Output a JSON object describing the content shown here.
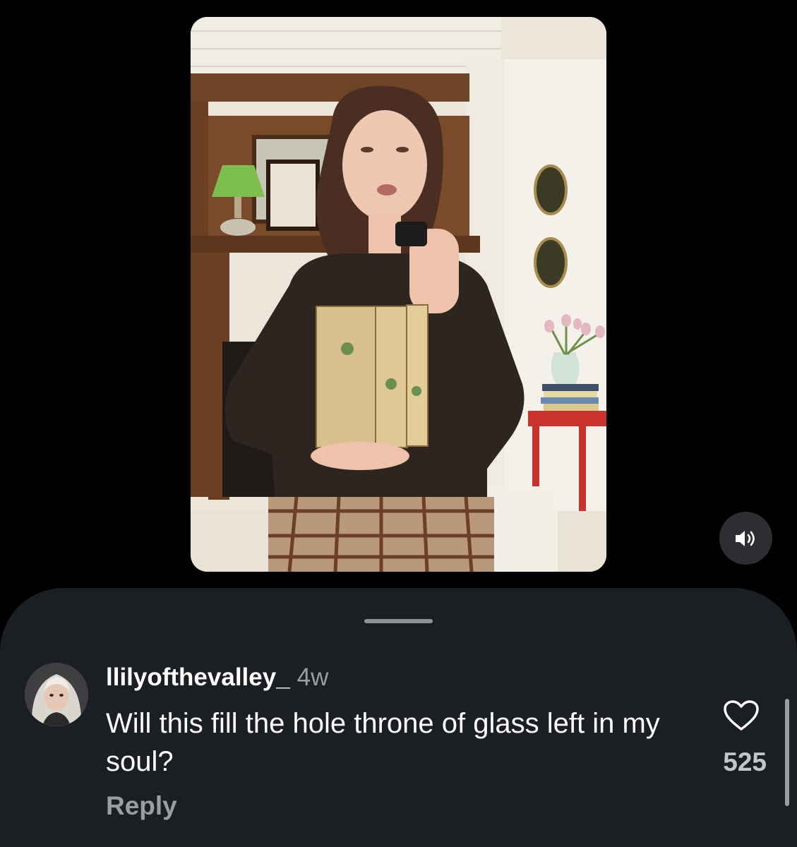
{
  "video": {
    "description_icon": "video-thumbnail",
    "mute_icon": "speaker-icon"
  },
  "comments_sheet": {
    "comment": {
      "username": "llilyofthevalley_",
      "time_ago": "4w",
      "text": "Will this fill the hole throne of glass left in my soul?",
      "reply_label": "Reply",
      "like_count": "525",
      "like_icon": "heart-icon"
    }
  },
  "colors": {
    "background": "#000000",
    "sheet_background": "#1b1e22",
    "secondary_text": "#9a9da2",
    "primary_text": "#ffffff"
  }
}
